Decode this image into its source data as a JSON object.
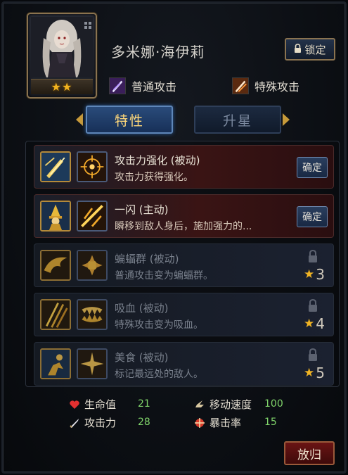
{
  "hero": {
    "name": "多米娜·海伊莉",
    "stars": "★★",
    "lock_label": "锁定"
  },
  "attacks": {
    "normal_label": "普通攻击",
    "special_label": "特殊攻击"
  },
  "tabs": {
    "traits": "特性",
    "upgrade_star": "升星"
  },
  "skills": [
    {
      "name": "攻击力强化 (被动)",
      "desc": "攻击力获得强化。",
      "action": "确定",
      "locked": false
    },
    {
      "name": "一闪 (主动)",
      "desc": "瞬移到敌人身后，施加强力的...",
      "action": "确定",
      "locked": false
    },
    {
      "name": "蝙蝠群 (被动)",
      "desc": "普通攻击变为蝙蝠群。",
      "req_star": "★",
      "req_num": "3",
      "locked": true
    },
    {
      "name": "吸血 (被动)",
      "desc": "特殊攻击变为吸血。",
      "req_star": "★",
      "req_num": "4",
      "locked": true
    },
    {
      "name": "美食 (被动)",
      "desc": "标记最远处的敌人。",
      "req_star": "★",
      "req_num": "5",
      "locked": true
    }
  ],
  "stats": {
    "hp_label": "生命值",
    "hp_value": "21",
    "atk_label": "攻击力",
    "atk_value": "28",
    "speed_label": "移动速度",
    "speed_value": "100",
    "crit_label": "暴击率",
    "crit_value": "15"
  },
  "return_label": "放归",
  "colors": {
    "gold": "#f2b420",
    "stat_value": "#7fd36a",
    "tab_active_text": "#ffd87a"
  }
}
